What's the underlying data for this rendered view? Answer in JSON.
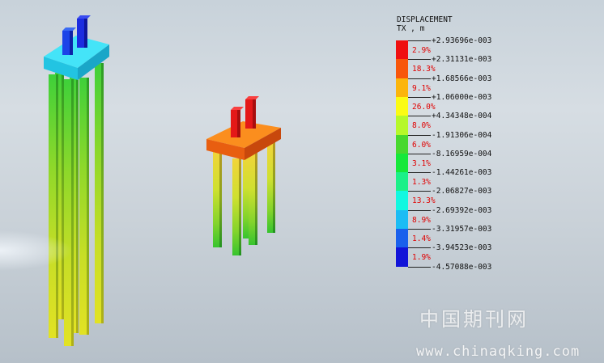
{
  "legend": {
    "title": "DISPLACEMENT",
    "subtitle": "TX , m",
    "colors": [
      "#ef1010",
      "#f8560a",
      "#fbb50c",
      "#fbfb14",
      "#b6f82a",
      "#48d82e",
      "#16e83a",
      "#1cf088",
      "#12f8e0",
      "#1cbcf4",
      "#1a60ec",
      "#1214d8"
    ],
    "values": [
      "+2.93696e-003",
      "+2.31131e-003",
      "+1.68566e-003",
      "+1.06000e-003",
      "+4.34348e-004",
      "-1.91306e-004",
      "-8.16959e-004",
      "-1.44261e-003",
      "-2.06827e-003",
      "-2.69392e-003",
      "-3.31957e-003",
      "-3.94523e-003",
      "-4.57088e-003"
    ],
    "percents": [
      "2.9%",
      "18.3%",
      "9.1%",
      "26.0%",
      "8.0%",
      "6.0%",
      "3.1%",
      "1.3%",
      "13.3%",
      "8.9%",
      "1.4%",
      "1.9%"
    ]
  },
  "watermark": {
    "chinese": "中国期刊网",
    "url": "www.chinaqking.com"
  }
}
